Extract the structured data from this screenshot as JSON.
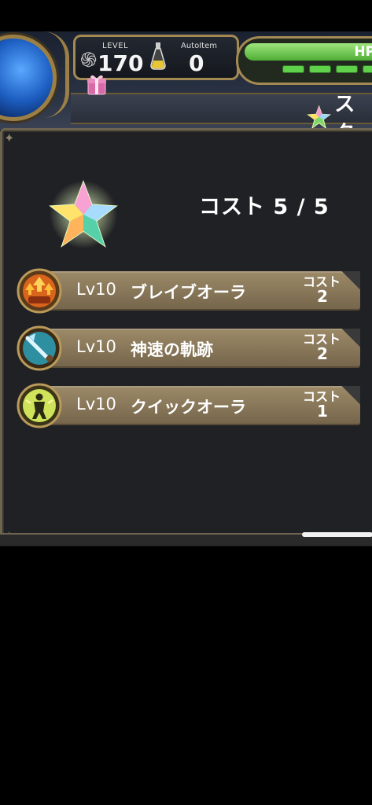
{
  "hud": {
    "level_label": "LEVEL",
    "level_value": "170",
    "auto_item_label": "AutoItem",
    "auto_item_value": "0",
    "hp_label": "HP",
    "title_fragment": "スタ"
  },
  "panel": {
    "cost_text": "コスト 5 / 5"
  },
  "skills": [
    {
      "level": "Lv10",
      "name": "ブレイブオーラ",
      "cost_label": "コスト",
      "cost_value": "2",
      "icon": "brave-aura-icon"
    },
    {
      "level": "Lv10",
      "name": "神速の軌跡",
      "cost_label": "コスト",
      "cost_value": "2",
      "icon": "godspeed-trail-icon"
    },
    {
      "level": "Lv10",
      "name": "クイックオーラ",
      "cost_label": "コスト",
      "cost_value": "1",
      "icon": "quick-aura-icon"
    }
  ],
  "colors": {
    "frame_gold": "#a48a52",
    "hp_green": "#5fd14a",
    "skill_bar": "#8a7a5a"
  }
}
